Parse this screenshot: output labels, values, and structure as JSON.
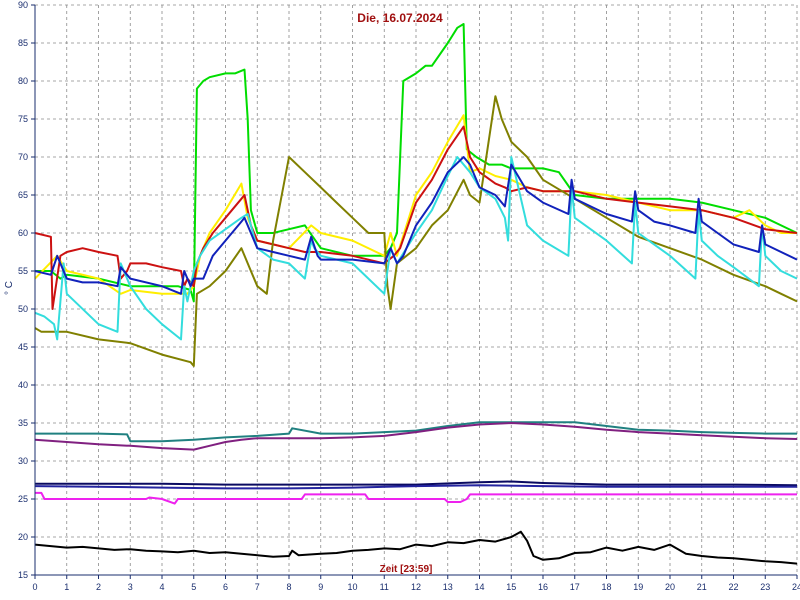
{
  "chart_data": {
    "type": "line",
    "title": "Die, 16.07.2024",
    "xlabel": "Zeit [23:59]",
    "ylabel": "° C",
    "xlim": [
      0,
      24
    ],
    "ylim": [
      15,
      90
    ],
    "xticks": [
      0,
      1,
      2,
      3,
      4,
      5,
      6,
      7,
      8,
      9,
      10,
      11,
      12,
      13,
      14,
      15,
      16,
      17,
      18,
      19,
      20,
      21,
      22,
      23,
      24
    ],
    "yticks": [
      15,
      20,
      25,
      30,
      35,
      40,
      45,
      50,
      55,
      60,
      65,
      70,
      75,
      80,
      85,
      90
    ],
    "grid": true,
    "series": [
      {
        "color": "#00dd00",
        "x": [
          0,
          0.5,
          0.8,
          1,
          2,
          3,
          4.5,
          4.9,
          5.0,
          5.1,
          5.3,
          5.5,
          6,
          6.3,
          6.6,
          6.7,
          6.8,
          7,
          7.5,
          8,
          8.5,
          9,
          10,
          11,
          11.2,
          11.4,
          11.6,
          12,
          12.3,
          12.5,
          13,
          13.3,
          13.5,
          13.6,
          13.9,
          14.3,
          14.7,
          15,
          15.5,
          16,
          16.5,
          17,
          18,
          19,
          20,
          21,
          22,
          23,
          23.5,
          24
        ],
        "y": [
          55,
          55,
          54,
          54.5,
          54,
          53,
          53,
          52.5,
          51,
          79,
          80,
          80.5,
          81,
          81,
          81.5,
          75,
          63,
          60,
          60,
          60.5,
          61,
          58,
          57,
          57,
          58,
          60,
          80,
          81,
          82,
          82,
          85,
          87,
          87.5,
          71,
          70,
          69,
          69,
          68.5,
          68.5,
          68.5,
          68,
          65,
          64.5,
          64.5,
          64.5,
          64,
          63,
          62,
          61,
          60
        ]
      },
      {
        "color": "#ffee00",
        "x": [
          0,
          0.7,
          1,
          2,
          2.7,
          3,
          4,
          4.8,
          5,
          5.2,
          5.5,
          6,
          6.5,
          6.7,
          7,
          7.5,
          8,
          8.7,
          9,
          10,
          11,
          11.2,
          11.4,
          12,
          12.5,
          13,
          13.5,
          13.7,
          14,
          14.5,
          15,
          15.5,
          16,
          17,
          18,
          19,
          20,
          21,
          22,
          22.5,
          23,
          23.5,
          24
        ],
        "y": [
          54,
          57,
          55,
          54,
          52,
          52.5,
          52,
          52,
          53,
          57,
          60,
          63,
          66.5,
          62,
          59,
          58.5,
          58,
          61,
          60,
          59,
          57,
          60,
          57,
          65,
          68,
          72,
          75.5,
          68,
          68.5,
          67.5,
          67,
          66,
          65.5,
          65.5,
          65,
          64,
          63,
          63,
          62,
          63,
          61,
          60,
          60
        ]
      },
      {
        "color": "#cc1111",
        "x": [
          0,
          0.5,
          0.55,
          0.8,
          1,
          1.5,
          2,
          2.6,
          2.7,
          2.9,
          3,
          3.5,
          4,
          4.6,
          4.7,
          4.8,
          5,
          5.1,
          5.3,
          5.6,
          6,
          6.5,
          6.6,
          6.8,
          7,
          7.5,
          8,
          8.5,
          8.8,
          9,
          10,
          11,
          11.3,
          11.5,
          12,
          12.5,
          13,
          13.5,
          13.7,
          14,
          14.5,
          14.8,
          15,
          15.5,
          16,
          17,
          18,
          19,
          20,
          21,
          22,
          23,
          24
        ],
        "y": [
          60,
          59.5,
          50,
          57,
          57.5,
          58,
          57.5,
          57,
          54,
          55,
          56,
          56,
          55.5,
          55,
          53,
          54,
          53,
          56,
          58,
          60,
          62,
          64.5,
          65,
          61,
          59,
          58.5,
          58,
          57.5,
          57.5,
          57.5,
          57,
          56,
          57,
          58,
          64,
          67,
          71,
          74,
          70,
          68,
          66.5,
          66,
          65.5,
          66,
          65.5,
          65.5,
          64.5,
          64,
          63.5,
          63,
          62,
          60.5,
          60
        ]
      },
      {
        "color": "#808000",
        "x": [
          0,
          0.2,
          1,
          2,
          3,
          4,
          4.9,
          5,
          5.1,
          5.5,
          6,
          6.5,
          6.8,
          7,
          7.3,
          7.5,
          8,
          8.5,
          9,
          9.5,
          10,
          10.5,
          11,
          11.1,
          11.2,
          11.4,
          12,
          12.5,
          13,
          13.5,
          13.7,
          14,
          14.5,
          14.7,
          15,
          15.5,
          16,
          17,
          18,
          19,
          20,
          21,
          22,
          23,
          23.5,
          24
        ],
        "y": [
          47.5,
          47,
          47,
          46,
          45.5,
          44,
          43,
          42.5,
          52,
          53,
          55,
          58,
          55,
          53,
          52,
          59,
          70,
          68,
          66,
          64,
          62,
          60,
          60,
          53,
          50,
          56,
          58,
          61,
          63,
          67,
          65,
          64,
          78,
          75,
          72,
          70,
          67,
          64.5,
          62,
          59.5,
          58,
          56.5,
          54.5,
          53,
          52,
          51
        ]
      },
      {
        "color": "#33dddd",
        "x": [
          0,
          0.3,
          0.6,
          0.7,
          0.9,
          1,
          2,
          2.6,
          2.7,
          2.9,
          3,
          3.5,
          4,
          4.6,
          4.7,
          4.8,
          5,
          5.2,
          5.5,
          6,
          6.5,
          6.7,
          7,
          7.5,
          8,
          8.5,
          8.7,
          8.8,
          9,
          10,
          11,
          11.2,
          11.4,
          12,
          12.5,
          13,
          13.3,
          13.7,
          14,
          14.5,
          14.8,
          14.9,
          15,
          15.5,
          16,
          16.8,
          16.9,
          17,
          17.5,
          18,
          18.8,
          18.9,
          19,
          19.5,
          20,
          20.8,
          20.9,
          21,
          21.5,
          22,
          22.8,
          22.9,
          23,
          23.5,
          24
        ],
        "y": [
          49.5,
          49,
          48,
          46,
          56,
          52,
          48,
          47,
          56,
          54,
          53,
          50,
          48,
          46,
          53,
          51,
          55,
          57,
          59,
          60.5,
          62,
          62.5,
          58,
          56.5,
          56,
          54,
          59,
          58,
          57,
          56,
          52,
          58,
          56,
          60,
          63,
          67.5,
          70,
          68,
          66,
          64.5,
          62,
          59,
          70,
          61,
          59,
          57,
          66,
          62,
          60.5,
          59,
          56,
          64,
          60,
          58.5,
          57,
          54,
          63,
          59,
          57,
          55.5,
          53,
          61,
          57,
          55,
          54
        ]
      },
      {
        "color": "#1122bb",
        "x": [
          0,
          0.5,
          0.7,
          1,
          1.5,
          2,
          2.6,
          2.7,
          3,
          4,
          4.6,
          4.7,
          4.9,
          5,
          5.3,
          5.6,
          6,
          6.5,
          6.6,
          6.8,
          7,
          7.5,
          8,
          8.5,
          8.7,
          8.9,
          9,
          10,
          11,
          11.2,
          11.4,
          11.6,
          12,
          12.5,
          13,
          13.5,
          13.7,
          14,
          14.5,
          14.8,
          15,
          15.5,
          16,
          16.8,
          16.9,
          17,
          17.5,
          18,
          18.8,
          18.9,
          19,
          19.5,
          20,
          20.8,
          20.9,
          21,
          21.5,
          22,
          22.8,
          22.9,
          23,
          23.5,
          24
        ],
        "y": [
          55,
          54.5,
          57,
          54,
          53.5,
          53.5,
          53,
          55.5,
          54,
          53,
          52,
          55,
          53,
          54,
          54,
          57,
          59,
          61.5,
          62,
          60,
          58,
          57.5,
          57,
          56.5,
          59.5,
          57,
          56.5,
          56.5,
          56,
          58,
          56,
          57,
          61,
          64,
          68,
          70,
          69,
          66,
          65,
          63.5,
          69,
          65.5,
          64,
          62.5,
          67,
          64.5,
          63.5,
          62.5,
          61.5,
          65.5,
          63,
          61.5,
          61,
          60,
          64.5,
          61.5,
          60,
          58.5,
          57.5,
          61,
          58.5,
          57.5,
          56.5
        ]
      },
      {
        "color": "#208080",
        "x": [
          0,
          1,
          2,
          2.9,
          3,
          4,
          5,
          6,
          7,
          8,
          8.1,
          9,
          10,
          11,
          12,
          13,
          14,
          15,
          16,
          17,
          18,
          19,
          20,
          21,
          22,
          23,
          24
        ],
        "y": [
          33.6,
          33.6,
          33.6,
          33.5,
          32.6,
          32.6,
          32.8,
          33.1,
          33.3,
          33.6,
          34.3,
          33.6,
          33.6,
          33.8,
          34,
          34.6,
          35.1,
          35.1,
          35.1,
          35.1,
          34.6,
          34.1,
          34,
          33.8,
          33.7,
          33.6,
          33.6
        ]
      },
      {
        "color": "#802080",
        "x": [
          0,
          1,
          2,
          3,
          4,
          5,
          5.5,
          6,
          6.5,
          7,
          8,
          9,
          10,
          11,
          12,
          13,
          14,
          15,
          16,
          17,
          18,
          19,
          20,
          21,
          22,
          23,
          24
        ],
        "y": [
          32.8,
          32.5,
          32.2,
          32,
          31.7,
          31.5,
          32,
          32.5,
          32.8,
          33,
          33,
          33,
          33.1,
          33.3,
          33.8,
          34.4,
          34.8,
          35,
          34.8,
          34.5,
          34.1,
          33.8,
          33.6,
          33.4,
          33.2,
          33,
          32.9
        ]
      },
      {
        "color": "#0a0a60",
        "x": [
          0,
          2,
          4,
          6,
          8,
          10,
          12,
          14,
          15,
          16,
          18,
          20,
          22,
          24
        ],
        "y": [
          27,
          27,
          27,
          26.9,
          26.9,
          26.9,
          26.9,
          27.2,
          27.3,
          27.1,
          26.9,
          26.9,
          26.9,
          26.8
        ]
      },
      {
        "color": "#2424a0",
        "x": [
          0,
          2,
          4,
          6,
          8,
          10,
          12,
          14,
          16,
          18,
          20,
          22,
          24
        ],
        "y": [
          26.7,
          26.6,
          26.5,
          26.4,
          26.4,
          26.5,
          26.7,
          26.8,
          26.7,
          26.6,
          26.6,
          26.6,
          26.6
        ]
      },
      {
        "color": "#ee22ee",
        "x": [
          0,
          0.2,
          0.3,
          1,
          2,
          3,
          3.5,
          3.6,
          4,
          4.4,
          4.5,
          5,
          7,
          8.4,
          8.5,
          10.4,
          10.5,
          12,
          12.9,
          13,
          13.4,
          13.6,
          13.7,
          15,
          20,
          24
        ],
        "y": [
          25.8,
          25.8,
          25,
          25,
          25,
          25,
          25,
          25.2,
          25,
          24.4,
          25,
          25,
          25,
          25,
          25.6,
          25.6,
          25,
          25,
          25,
          24.6,
          24.6,
          25,
          25.6,
          25.6,
          25.6,
          25.6
        ]
      },
      {
        "color": "#000000",
        "x": [
          0,
          0.5,
          1,
          1.5,
          2,
          2.5,
          3,
          3.5,
          4,
          4.5,
          5,
          5.5,
          6,
          6.5,
          7,
          7.5,
          8,
          8.1,
          8.3,
          9,
          9.5,
          10,
          10.5,
          11,
          11.5,
          12,
          12.5,
          13,
          13.5,
          14,
          14.5,
          15,
          15.3,
          15.5,
          15.7,
          16,
          16.5,
          17,
          17.5,
          18,
          18.5,
          19,
          19.5,
          20,
          20.5,
          21,
          21.5,
          22,
          22.5,
          23,
          23.5,
          24
        ],
        "y": [
          19,
          18.8,
          18.6,
          18.7,
          18.5,
          18.3,
          18.4,
          18.2,
          18.1,
          18,
          18.2,
          17.9,
          18,
          17.8,
          17.6,
          17.4,
          17.5,
          18.2,
          17.6,
          17.8,
          17.9,
          18.2,
          18.3,
          18.5,
          18.4,
          19,
          18.8,
          19.3,
          19.2,
          19.6,
          19.4,
          20,
          20.7,
          19.5,
          17.5,
          17,
          17.2,
          17.9,
          18,
          18.6,
          18.2,
          18.7,
          18.3,
          19,
          17.8,
          17.5,
          17.3,
          17.2,
          17,
          16.8,
          16.7,
          16.5
        ]
      }
    ]
  }
}
